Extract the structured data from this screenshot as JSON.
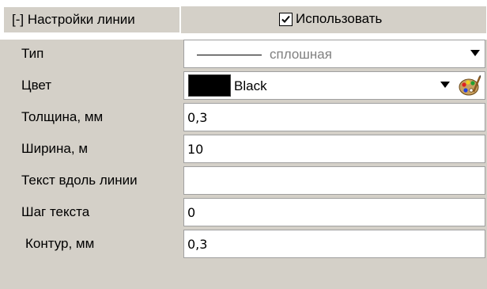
{
  "header": {
    "title": "[-] Настройки линии",
    "use_label": "Использовать",
    "use_checked": true
  },
  "rows": [
    {
      "label": "Тип",
      "value": "сплошная",
      "kind": "line-type"
    },
    {
      "label": "Цвет",
      "value": "Black",
      "kind": "color",
      "color": "#000000"
    },
    {
      "label": "Толщина, мм",
      "value": "0,3",
      "kind": "text"
    },
    {
      "label": "Ширина, м",
      "value": "10",
      "kind": "text"
    },
    {
      "label": "Текст вдоль линии",
      "value": "",
      "kind": "text"
    },
    {
      "label": "Шаг текста",
      "value": "0",
      "kind": "text"
    },
    {
      "label": "Контур, мм",
      "value": "0,3",
      "kind": "text"
    }
  ],
  "icons": {
    "dropdown": "chevron-down-icon",
    "palette": "palette-icon",
    "checkbox": "checkmark-icon"
  },
  "colors": {
    "panel_bg": "#d4d0c8",
    "field_bg": "#ffffff",
    "field_border": "#a0a0a0",
    "muted_text": "#808080"
  }
}
